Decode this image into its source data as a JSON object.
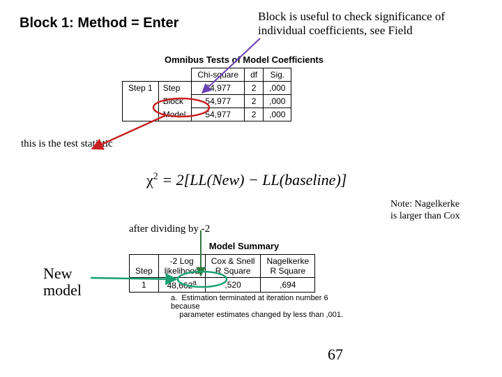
{
  "heading": "Block 1: Method = Enter",
  "top_note_line1": "Block is useful to check significance of",
  "top_note_line2": "individual coefficients, see Field",
  "omnibus": {
    "title": "Omnibus Tests of Model Coefficients",
    "col_chi": "Chi-square",
    "col_df": "df",
    "col_sig": "Sig.",
    "step_label": "Step 1",
    "rows": [
      {
        "name": "Step",
        "chi": "54,977",
        "df": "2",
        "sig": ",000"
      },
      {
        "name": "Block",
        "chi": "54,977",
        "df": "2",
        "sig": ",000"
      },
      {
        "name": "Model",
        "chi": "54,977",
        "df": "2",
        "sig": ",000"
      }
    ]
  },
  "test_stat_note": "this is the test statistic",
  "formula": "χ² = 2[LL(New) − LL(baseline)]",
  "after_dividing": "after dividing by -2",
  "new_model": "New\nmodel",
  "model_summary": {
    "title": "Model Summary",
    "col_step": "Step",
    "col_2ll_l1": "-2 Log",
    "col_2ll_l2": "likelihood",
    "col_cox_l1": "Cox & Snell",
    "col_cox_l2": "R Square",
    "col_nag_l1": "Nagelkerke",
    "col_nag_l2": "R Square",
    "row_step": "1",
    "row_2ll": "48,662",
    "row_2ll_sup": "a",
    "row_cox": ",520",
    "row_nag": ",694",
    "footnote_label": "a.",
    "footnote_l1": "Estimation terminated at iteration number 6 because",
    "footnote_l2": "parameter estimates changed by less than ,001."
  },
  "nagelkerke_note_l1": "Note: Nagelkerke",
  "nagelkerke_note_l2": "is larger than Cox",
  "page_number": "67"
}
